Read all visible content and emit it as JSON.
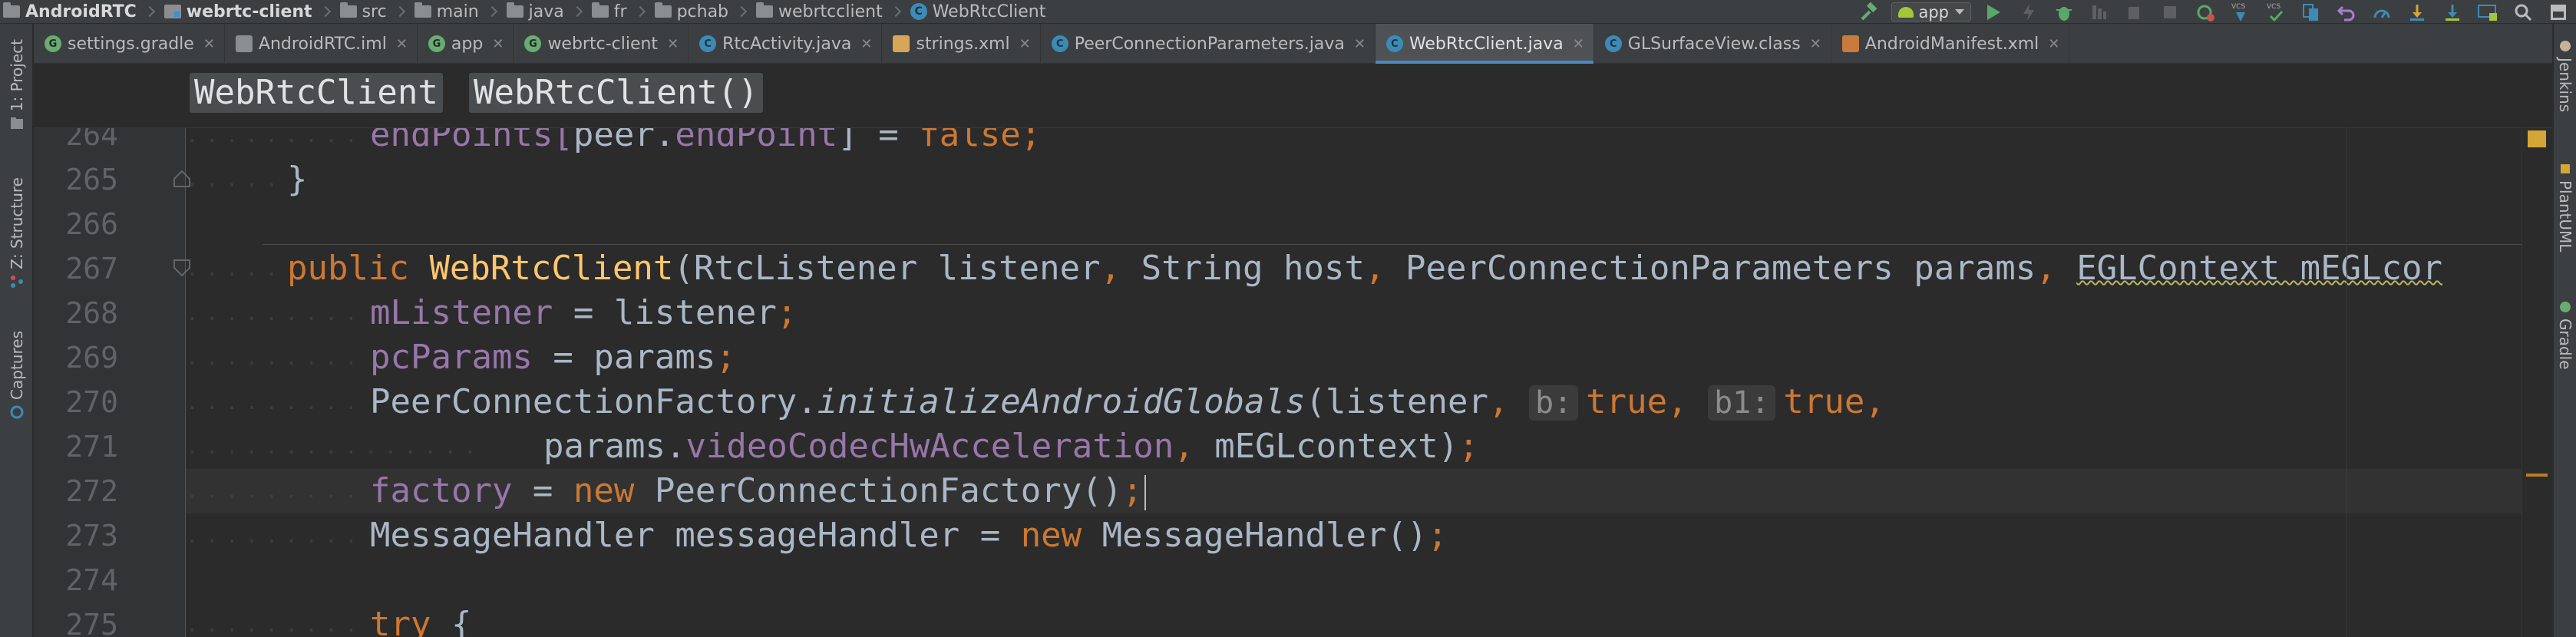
{
  "navbar": {
    "crumbs": [
      {
        "label": "AndroidRTC",
        "icon": "project-folder-icon",
        "bold": true
      },
      {
        "label": "webrtc-client",
        "icon": "module-icon",
        "bold": true
      },
      {
        "label": "src",
        "icon": "folder-icon",
        "bold": false
      },
      {
        "label": "main",
        "icon": "folder-icon",
        "bold": false
      },
      {
        "label": "java",
        "icon": "folder-icon",
        "bold": false
      },
      {
        "label": "fr",
        "icon": "folder-icon",
        "bold": false
      },
      {
        "label": "pchab",
        "icon": "folder-icon",
        "bold": false
      },
      {
        "label": "webrtcclient",
        "icon": "folder-icon",
        "bold": false
      },
      {
        "label": "WebRtcClient",
        "icon": "class-icon",
        "bold": false
      }
    ],
    "run_config": "app"
  },
  "left_strip": {
    "project": "1: Project",
    "structure": "Z: Structure",
    "captures": "Captures"
  },
  "right_strip": {
    "jenkins": "Jenkins",
    "plantuml": "PlantUML",
    "gradle": "Gradle"
  },
  "tabs": [
    {
      "label": "settings.gradle",
      "icon": "gradle-icon",
      "active": false
    },
    {
      "label": "AndroidRTC.iml",
      "icon": "iml-file-icon",
      "active": false
    },
    {
      "label": "app",
      "icon": "module-icon",
      "active": false
    },
    {
      "label": "webrtc-client",
      "icon": "module-icon",
      "active": false
    },
    {
      "label": "RtcActivity.java",
      "icon": "class-icon",
      "active": false
    },
    {
      "label": "strings.xml",
      "icon": "xml-file-icon",
      "active": false
    },
    {
      "label": "PeerConnectionParameters.java",
      "icon": "class-icon",
      "active": false
    },
    {
      "label": "WebRtcClient.java",
      "icon": "class-icon",
      "active": true
    },
    {
      "label": "GLSurfaceView.class",
      "icon": "class-icon",
      "active": false
    },
    {
      "label": "AndroidManifest.xml",
      "icon": "manifest-icon",
      "active": false
    }
  ],
  "context": {
    "class_name": "WebRtcClient",
    "method_name": "WebRtcClient()"
  },
  "editor": {
    "line_numbers": [
      "264",
      "265",
      "266",
      "267",
      "268",
      "269",
      "270",
      "271",
      "272",
      "273",
      "274",
      "275"
    ],
    "lines": {
      "l264": {
        "a": "endPoints[",
        "b": "peer.",
        "c": "endPoint",
        "d": "] = ",
        "e": "false",
        "f": ";"
      },
      "l265": {
        "a": "}"
      },
      "l267": {
        "a": "public ",
        "b": "WebRtcClient",
        "c": "(RtcListener listener",
        "d": ", ",
        "e": "String host",
        "f": ", ",
        "g": "PeerConnectionParameters params",
        "h": ", ",
        "i": "EGLContext mEGLcor"
      },
      "l268": {
        "a": "mListener",
        "b": " = listener",
        "c": ";"
      },
      "l269": {
        "a": "pcParams",
        "b": " = params",
        "c": ";"
      },
      "l270": {
        "a": "PeerConnectionFactory.",
        "b": "initializeAndroidGlobals",
        "c": "(listener",
        "d": ", ",
        "hint1": "b:",
        "e": "true",
        "f": ", ",
        "hint2": "b1:",
        "g": "true",
        "h": ","
      },
      "l271": {
        "a": "params.",
        "b": "videoCodecHwAcceleration",
        "c": ", ",
        "d": "mEGLcontext)",
        "e": ";"
      },
      "l272": {
        "a": "factory",
        "b": " = ",
        "c": "new ",
        "d": "PeerConnectionFactory()",
        "e": ";"
      },
      "l273": {
        "a": "MessageHandler messageHandler = ",
        "b": "new ",
        "c": "MessageHandler()",
        "d": ";"
      },
      "l275": {
        "a": "try ",
        "b": "{"
      }
    }
  },
  "colors": {
    "keyword": "#cc7832",
    "field": "#9876aa",
    "method_decl": "#ffc66d",
    "plain": "#a9b7c6",
    "active_tab_underline": "#4a88c7"
  }
}
